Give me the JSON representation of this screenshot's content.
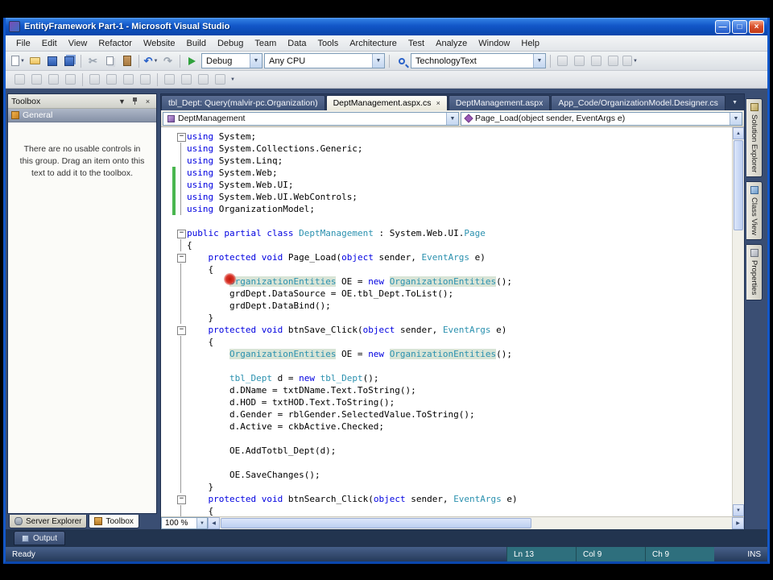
{
  "window": {
    "title": "EntityFramework Part-1 - Microsoft Visual Studio"
  },
  "menu": {
    "items": [
      "File",
      "Edit",
      "View",
      "Refactor",
      "Website",
      "Build",
      "Debug",
      "Team",
      "Data",
      "Tools",
      "Architecture",
      "Test",
      "Analyze",
      "Window",
      "Help"
    ]
  },
  "toolbar": {
    "config": "Debug",
    "platform": "Any CPU",
    "search": "TechnologyText"
  },
  "toolbox": {
    "title": "Toolbox",
    "group": "General",
    "empty_text": "There are no usable controls in this group. Drag an item onto this text to add it to the toolbox."
  },
  "tabs": [
    {
      "label": "tbl_Dept: Query(malvir-pc.Organization)",
      "active": false
    },
    {
      "label": "DeptManagement.aspx.cs",
      "active": true
    },
    {
      "label": "DeptManagement.aspx",
      "active": false
    },
    {
      "label": "App_Code/OrganizationModel.Designer.cs",
      "active": false
    }
  ],
  "navbar": {
    "type_dropdown": "DeptManagement",
    "member_dropdown": "Page_Load(object sender, EventArgs e)"
  },
  "editor": {
    "zoom": "100 %"
  },
  "side_tabs": [
    "Solution Explorer",
    "Class View",
    "Properties"
  ],
  "bottom_tabs": [
    "Server Explorer",
    "Toolbox"
  ],
  "output_tab": "Output",
  "status": {
    "text": "Ready",
    "line": "Ln 13",
    "col": "Col 9",
    "ch": "Ch 9",
    "mode": "INS"
  },
  "icons": {
    "dropdown": "▼",
    "undo": "↶",
    "redo": "↷",
    "cut": "✂",
    "close": "×",
    "minimize": "—",
    "maximize": "□",
    "up": "▲",
    "down": "▼",
    "left": "◀",
    "right": "▶"
  },
  "code": {
    "lines": [
      {
        "f": "minus",
        "b": 0,
        "t": [
          [
            "k",
            "using"
          ],
          [
            "p",
            " System;"
          ]
        ]
      },
      {
        "f": "vert",
        "b": 0,
        "t": [
          [
            "k",
            "using"
          ],
          [
            "p",
            " System.Collections.Generic;"
          ]
        ]
      },
      {
        "f": "vert",
        "b": 0,
        "t": [
          [
            "k",
            "using"
          ],
          [
            "p",
            " System.Linq;"
          ]
        ]
      },
      {
        "f": "vert",
        "b": 1,
        "t": [
          [
            "k",
            "using"
          ],
          [
            "p",
            " System.Web;"
          ]
        ]
      },
      {
        "f": "vert",
        "b": 1,
        "t": [
          [
            "k",
            "using"
          ],
          [
            "p",
            " System.Web.UI;"
          ]
        ]
      },
      {
        "f": "vert",
        "b": 1,
        "t": [
          [
            "k",
            "using"
          ],
          [
            "p",
            " System.Web.UI.WebControls;"
          ]
        ]
      },
      {
        "f": "vert",
        "b": 1,
        "t": [
          [
            "k",
            "using"
          ],
          [
            "p",
            " OrganizationModel;"
          ]
        ]
      },
      {
        "f": "none",
        "b": 0,
        "t": []
      },
      {
        "f": "minus",
        "b": 0,
        "t": [
          [
            "k",
            "public"
          ],
          [
            "p",
            " "
          ],
          [
            "k",
            "partial"
          ],
          [
            "p",
            " "
          ],
          [
            "k",
            "class"
          ],
          [
            "p",
            " "
          ],
          [
            "t",
            "DeptManagement"
          ],
          [
            "p",
            " : System.Web.UI."
          ],
          [
            "t",
            "Page"
          ]
        ]
      },
      {
        "f": "vert",
        "b": 0,
        "t": [
          [
            "p",
            "{"
          ]
        ]
      },
      {
        "f": "minus",
        "b": 0,
        "t": [
          [
            "p",
            "    "
          ],
          [
            "k",
            "protected"
          ],
          [
            "p",
            " "
          ],
          [
            "k",
            "void"
          ],
          [
            "p",
            " Page_Load("
          ],
          [
            "k",
            "object"
          ],
          [
            "p",
            " sender, "
          ],
          [
            "t",
            "EventArgs"
          ],
          [
            "p",
            " e)"
          ]
        ]
      },
      {
        "f": "vert",
        "b": 0,
        "t": [
          [
            "p",
            "    {"
          ]
        ]
      },
      {
        "f": "vert",
        "b": 0,
        "t": [
          [
            "p",
            "        "
          ],
          [
            "th",
            "OrganizationEntities"
          ],
          [
            "p",
            " OE = "
          ],
          [
            "k",
            "new"
          ],
          [
            "p",
            " "
          ],
          [
            "th",
            "OrganizationEntities"
          ],
          [
            "p",
            "();"
          ]
        ]
      },
      {
        "f": "vert",
        "b": 0,
        "t": [
          [
            "p",
            "        grdDept.DataSource = OE.tbl_Dept.ToList();"
          ]
        ]
      },
      {
        "f": "vert",
        "b": 0,
        "t": [
          [
            "p",
            "        grdDept.DataBind();"
          ]
        ]
      },
      {
        "f": "vert",
        "b": 0,
        "t": [
          [
            "p",
            "    }"
          ]
        ]
      },
      {
        "f": "minus",
        "b": 0,
        "t": [
          [
            "p",
            "    "
          ],
          [
            "k",
            "protected"
          ],
          [
            "p",
            " "
          ],
          [
            "k",
            "void"
          ],
          [
            "p",
            " btnSave_Click("
          ],
          [
            "k",
            "object"
          ],
          [
            "p",
            " sender, "
          ],
          [
            "t",
            "EventArgs"
          ],
          [
            "p",
            " e)"
          ]
        ]
      },
      {
        "f": "vert",
        "b": 0,
        "t": [
          [
            "p",
            "    {"
          ]
        ]
      },
      {
        "f": "vert",
        "b": 0,
        "t": [
          [
            "p",
            "        "
          ],
          [
            "th",
            "OrganizationEntities"
          ],
          [
            "p",
            " OE = "
          ],
          [
            "k",
            "new"
          ],
          [
            "p",
            " "
          ],
          [
            "th",
            "OrganizationEntities"
          ],
          [
            "p",
            "();"
          ]
        ]
      },
      {
        "f": "vert",
        "b": 0,
        "t": []
      },
      {
        "f": "vert",
        "b": 0,
        "t": [
          [
            "p",
            "        "
          ],
          [
            "t",
            "tbl_Dept"
          ],
          [
            "p",
            " d = "
          ],
          [
            "k",
            "new"
          ],
          [
            "p",
            " "
          ],
          [
            "t",
            "tbl_Dept"
          ],
          [
            "p",
            "();"
          ]
        ]
      },
      {
        "f": "vert",
        "b": 0,
        "t": [
          [
            "p",
            "        d.DName = txtDName.Text.ToString();"
          ]
        ]
      },
      {
        "f": "vert",
        "b": 0,
        "t": [
          [
            "p",
            "        d.HOD = txtHOD.Text.ToString();"
          ]
        ]
      },
      {
        "f": "vert",
        "b": 0,
        "t": [
          [
            "p",
            "        d.Gender = rblGender.SelectedValue.ToString();"
          ]
        ]
      },
      {
        "f": "vert",
        "b": 0,
        "t": [
          [
            "p",
            "        d.Active = ckbActive.Checked;"
          ]
        ]
      },
      {
        "f": "vert",
        "b": 0,
        "t": []
      },
      {
        "f": "vert",
        "b": 0,
        "t": [
          [
            "p",
            "        OE.AddTotbl_Dept(d);"
          ]
        ]
      },
      {
        "f": "vert",
        "b": 0,
        "t": []
      },
      {
        "f": "vert",
        "b": 0,
        "t": [
          [
            "p",
            "        OE.SaveChanges();"
          ]
        ]
      },
      {
        "f": "vert",
        "b": 0,
        "t": [
          [
            "p",
            "    }"
          ]
        ]
      },
      {
        "f": "minus",
        "b": 0,
        "t": [
          [
            "p",
            "    "
          ],
          [
            "k",
            "protected"
          ],
          [
            "p",
            " "
          ],
          [
            "k",
            "void"
          ],
          [
            "p",
            " btnSearch_Click("
          ],
          [
            "k",
            "object"
          ],
          [
            "p",
            " sender, "
          ],
          [
            "t",
            "EventArgs"
          ],
          [
            "p",
            " e)"
          ]
        ]
      },
      {
        "f": "vert",
        "b": 0,
        "t": [
          [
            "p",
            "    {"
          ]
        ]
      }
    ]
  }
}
